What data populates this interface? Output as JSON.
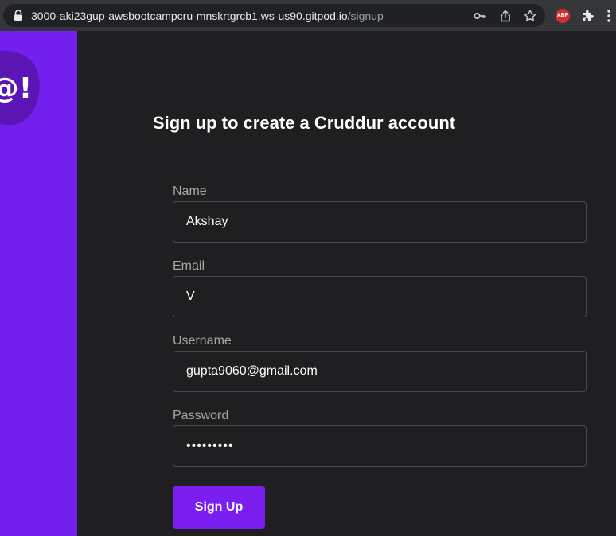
{
  "browser": {
    "url_host": "3000-aki23gup-awsbootcampcru-mnskrtgrcb1.ws-us90.gitpod.io",
    "url_path": "/signup",
    "extension_abp_label": "ABP"
  },
  "page": {
    "title": "Sign up to create a Cruddur account",
    "logo_glyph": "@!",
    "colors": {
      "brand": "#7320ee",
      "background": "#1f1e20",
      "button": "#7a1ff0"
    }
  },
  "form": {
    "name": {
      "label": "Name",
      "value": "Akshay"
    },
    "email": {
      "label": "Email",
      "value": "V"
    },
    "username": {
      "label": "Username",
      "value": "gupta9060@gmail.com"
    },
    "password": {
      "label": "Password",
      "value": "•••••••••"
    },
    "submit_label": "Sign Up"
  }
}
